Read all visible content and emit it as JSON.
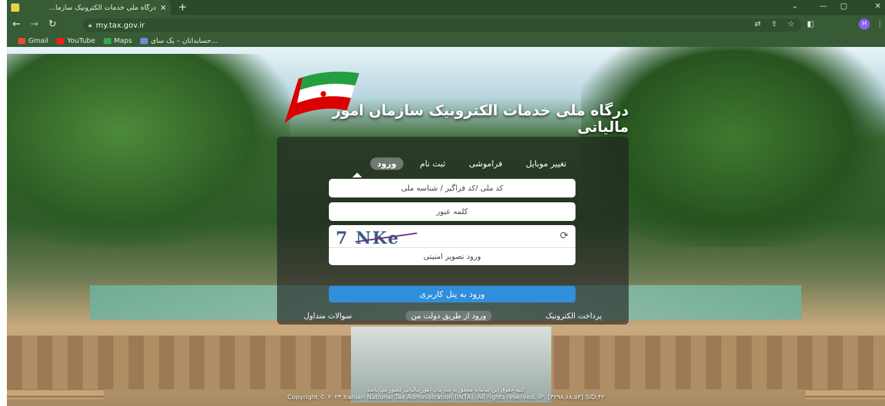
{
  "browser": {
    "tab_title": "درگاه ملی خدمات الکترونیک سازما...",
    "tab_close": "✕",
    "new_tab": "+",
    "url": "my.tax.gov.ir",
    "window_controls": [
      "⌄",
      "—",
      "▢",
      "✕"
    ],
    "profile_initial": "H",
    "bookmarks": [
      {
        "label": "Gmail",
        "color": "#e4493a"
      },
      {
        "label": "YouTube",
        "color": "#ff1a1a"
      },
      {
        "label": "Maps",
        "color": "#34a853"
      },
      {
        "label": "حسابداتان – یک سای...",
        "color": "#6c8cd4"
      }
    ]
  },
  "page": {
    "site_title": "درگاه ملی خدمات الکترونیک سازمان امور مالیاتی",
    "tabs": [
      {
        "label": "ورود",
        "active": true
      },
      {
        "label": "ثبت نام",
        "active": false
      },
      {
        "label": "فراموشی",
        "active": false
      },
      {
        "label": "تغییر موبایل",
        "active": false
      }
    ],
    "username_placeholder": "کد ملی /کد فراگیر / شناسه ملی",
    "password_placeholder": "کلمه عبور",
    "captcha_text": "7 NKe",
    "captcha_placeholder": "ورود تصویر امنیتی",
    "submit_label": "ورود به پنل کاربری",
    "footer_links": [
      "پرداخت الکترونیک",
      "ورود از طریق دولت من",
      "سوالات متداول"
    ],
    "copyright_fa": "کلیه حقوق این سامانه متعلق به سازمان امور مالیاتی کشور می باشد",
    "copyright_en": "Copyright © ۲۰۲۳ Iranian National Tax Administration (INTA). All rights reserved. IP: [۳۲۹۸.۶۸.۵۳] SID:۴۲"
  },
  "colors": {
    "chrome": "#375c35",
    "submit": "#2f8fdc",
    "flag_green": "#239f40",
    "flag_red": "#da0000"
  }
}
